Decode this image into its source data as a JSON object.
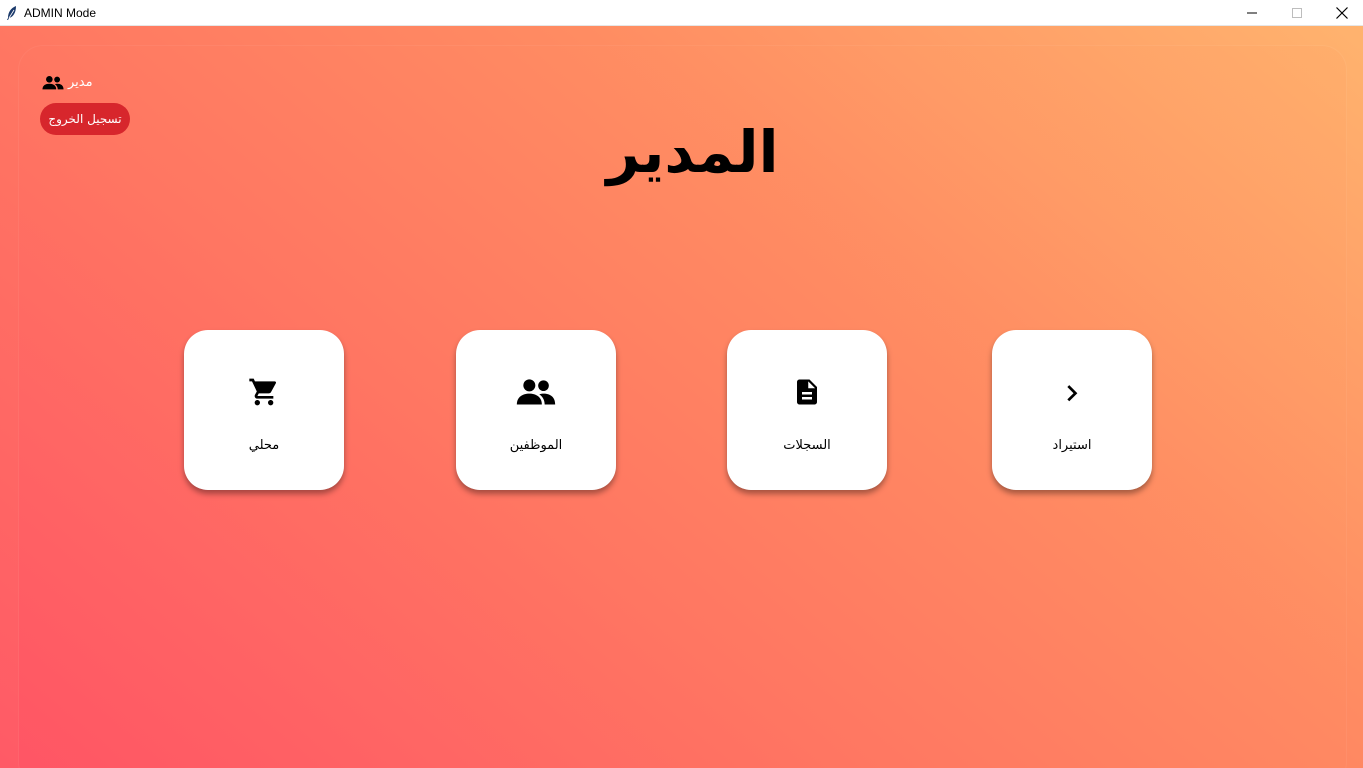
{
  "window": {
    "title": "ADMIN Mode"
  },
  "header": {
    "user_label": "مدير",
    "logout_label": "تسجيل الخروج",
    "page_title": "المدير"
  },
  "cards": [
    {
      "label": "محلي",
      "icon": "shopping-cart-icon"
    },
    {
      "label": "الموظفين",
      "icon": "people-icon"
    },
    {
      "label": "السجلات",
      "icon": "document-icon"
    },
    {
      "label": "استيراد",
      "icon": "chevron-right-icon"
    }
  ],
  "colors": {
    "logout_button": "#d7262c",
    "gradient_start": "#ff5a66",
    "gradient_end": "#ffb36e",
    "card_background": "#ffffff"
  }
}
